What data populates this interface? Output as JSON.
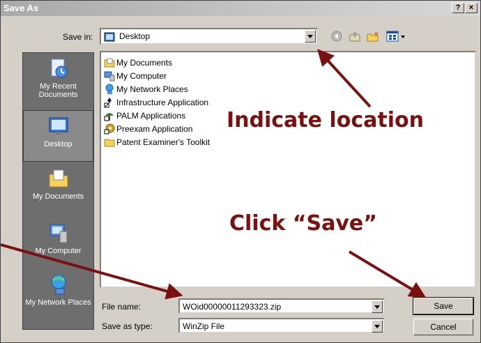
{
  "window": {
    "title": "Save As",
    "help_label": "?",
    "close_label": "×"
  },
  "save_in": {
    "label": "Save in:",
    "value": "Desktop"
  },
  "places": [
    {
      "label": "My Recent Documents",
      "icon": "recent-documents-icon"
    },
    {
      "label": "Desktop",
      "icon": "desktop-icon"
    },
    {
      "label": "My Documents",
      "icon": "my-documents-icon"
    },
    {
      "label": "My Computer",
      "icon": "my-computer-icon"
    },
    {
      "label": "My Network Places",
      "icon": "network-places-icon"
    }
  ],
  "files": [
    {
      "name": "My Documents",
      "icon": "folder-documents-icon"
    },
    {
      "name": "My Computer",
      "icon": "computer-icon"
    },
    {
      "name": "My Network Places",
      "icon": "network-icon"
    },
    {
      "name": "Infrastructure Application",
      "icon": "shortcut-icon"
    },
    {
      "name": "PALM Applications",
      "icon": "shortcut-icon"
    },
    {
      "name": "Preexam Application",
      "icon": "shortcut-icon"
    },
    {
      "name": "Patent Examiner's Toolkit",
      "icon": "folder-icon"
    }
  ],
  "file_name": {
    "label": "File name:",
    "value": "WOid00000011293323.zip"
  },
  "save_as_type": {
    "label": "Save as type:",
    "value": "WinZip File"
  },
  "buttons": {
    "save": "Save",
    "cancel": "Cancel"
  },
  "annotations": {
    "location": "Indicate location",
    "save": "Click “Save”"
  },
  "colors": {
    "annotation": "#7a1010",
    "title_bar": "#a9a9a9",
    "dialog_bg": "#d4d0c8"
  }
}
